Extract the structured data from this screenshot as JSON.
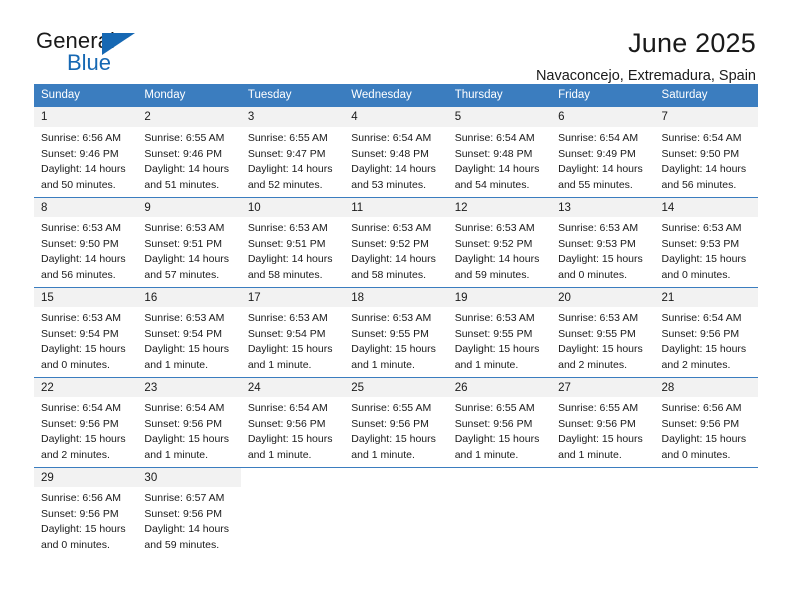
{
  "brand": {
    "name_part1": "General",
    "name_part2": "Blue",
    "accent_color": "#1668b3"
  },
  "header": {
    "title": "June 2025",
    "subtitle": "Navaconcejo, Extremadura, Spain"
  },
  "calendar": {
    "header_bg": "#3b7dbf",
    "daynum_bg": "#f2f2f2",
    "weekday_headers": [
      "Sunday",
      "Monday",
      "Tuesday",
      "Wednesday",
      "Thursday",
      "Friday",
      "Saturday"
    ],
    "weeks": [
      [
        {
          "day": "1",
          "sunrise": "Sunrise: 6:56 AM",
          "sunset": "Sunset: 9:46 PM",
          "daylight1": "Daylight: 14 hours",
          "daylight2": "and 50 minutes."
        },
        {
          "day": "2",
          "sunrise": "Sunrise: 6:55 AM",
          "sunset": "Sunset: 9:46 PM",
          "daylight1": "Daylight: 14 hours",
          "daylight2": "and 51 minutes."
        },
        {
          "day": "3",
          "sunrise": "Sunrise: 6:55 AM",
          "sunset": "Sunset: 9:47 PM",
          "daylight1": "Daylight: 14 hours",
          "daylight2": "and 52 minutes."
        },
        {
          "day": "4",
          "sunrise": "Sunrise: 6:54 AM",
          "sunset": "Sunset: 9:48 PM",
          "daylight1": "Daylight: 14 hours",
          "daylight2": "and 53 minutes."
        },
        {
          "day": "5",
          "sunrise": "Sunrise: 6:54 AM",
          "sunset": "Sunset: 9:48 PM",
          "daylight1": "Daylight: 14 hours",
          "daylight2": "and 54 minutes."
        },
        {
          "day": "6",
          "sunrise": "Sunrise: 6:54 AM",
          "sunset": "Sunset: 9:49 PM",
          "daylight1": "Daylight: 14 hours",
          "daylight2": "and 55 minutes."
        },
        {
          "day": "7",
          "sunrise": "Sunrise: 6:54 AM",
          "sunset": "Sunset: 9:50 PM",
          "daylight1": "Daylight: 14 hours",
          "daylight2": "and 56 minutes."
        }
      ],
      [
        {
          "day": "8",
          "sunrise": "Sunrise: 6:53 AM",
          "sunset": "Sunset: 9:50 PM",
          "daylight1": "Daylight: 14 hours",
          "daylight2": "and 56 minutes."
        },
        {
          "day": "9",
          "sunrise": "Sunrise: 6:53 AM",
          "sunset": "Sunset: 9:51 PM",
          "daylight1": "Daylight: 14 hours",
          "daylight2": "and 57 minutes."
        },
        {
          "day": "10",
          "sunrise": "Sunrise: 6:53 AM",
          "sunset": "Sunset: 9:51 PM",
          "daylight1": "Daylight: 14 hours",
          "daylight2": "and 58 minutes."
        },
        {
          "day": "11",
          "sunrise": "Sunrise: 6:53 AM",
          "sunset": "Sunset: 9:52 PM",
          "daylight1": "Daylight: 14 hours",
          "daylight2": "and 58 minutes."
        },
        {
          "day": "12",
          "sunrise": "Sunrise: 6:53 AM",
          "sunset": "Sunset: 9:52 PM",
          "daylight1": "Daylight: 14 hours",
          "daylight2": "and 59 minutes."
        },
        {
          "day": "13",
          "sunrise": "Sunrise: 6:53 AM",
          "sunset": "Sunset: 9:53 PM",
          "daylight1": "Daylight: 15 hours",
          "daylight2": "and 0 minutes."
        },
        {
          "day": "14",
          "sunrise": "Sunrise: 6:53 AM",
          "sunset": "Sunset: 9:53 PM",
          "daylight1": "Daylight: 15 hours",
          "daylight2": "and 0 minutes."
        }
      ],
      [
        {
          "day": "15",
          "sunrise": "Sunrise: 6:53 AM",
          "sunset": "Sunset: 9:54 PM",
          "daylight1": "Daylight: 15 hours",
          "daylight2": "and 0 minutes."
        },
        {
          "day": "16",
          "sunrise": "Sunrise: 6:53 AM",
          "sunset": "Sunset: 9:54 PM",
          "daylight1": "Daylight: 15 hours",
          "daylight2": "and 1 minute."
        },
        {
          "day": "17",
          "sunrise": "Sunrise: 6:53 AM",
          "sunset": "Sunset: 9:54 PM",
          "daylight1": "Daylight: 15 hours",
          "daylight2": "and 1 minute."
        },
        {
          "day": "18",
          "sunrise": "Sunrise: 6:53 AM",
          "sunset": "Sunset: 9:55 PM",
          "daylight1": "Daylight: 15 hours",
          "daylight2": "and 1 minute."
        },
        {
          "day": "19",
          "sunrise": "Sunrise: 6:53 AM",
          "sunset": "Sunset: 9:55 PM",
          "daylight1": "Daylight: 15 hours",
          "daylight2": "and 1 minute."
        },
        {
          "day": "20",
          "sunrise": "Sunrise: 6:53 AM",
          "sunset": "Sunset: 9:55 PM",
          "daylight1": "Daylight: 15 hours",
          "daylight2": "and 2 minutes."
        },
        {
          "day": "21",
          "sunrise": "Sunrise: 6:54 AM",
          "sunset": "Sunset: 9:56 PM",
          "daylight1": "Daylight: 15 hours",
          "daylight2": "and 2 minutes."
        }
      ],
      [
        {
          "day": "22",
          "sunrise": "Sunrise: 6:54 AM",
          "sunset": "Sunset: 9:56 PM",
          "daylight1": "Daylight: 15 hours",
          "daylight2": "and 2 minutes."
        },
        {
          "day": "23",
          "sunrise": "Sunrise: 6:54 AM",
          "sunset": "Sunset: 9:56 PM",
          "daylight1": "Daylight: 15 hours",
          "daylight2": "and 1 minute."
        },
        {
          "day": "24",
          "sunrise": "Sunrise: 6:54 AM",
          "sunset": "Sunset: 9:56 PM",
          "daylight1": "Daylight: 15 hours",
          "daylight2": "and 1 minute."
        },
        {
          "day": "25",
          "sunrise": "Sunrise: 6:55 AM",
          "sunset": "Sunset: 9:56 PM",
          "daylight1": "Daylight: 15 hours",
          "daylight2": "and 1 minute."
        },
        {
          "day": "26",
          "sunrise": "Sunrise: 6:55 AM",
          "sunset": "Sunset: 9:56 PM",
          "daylight1": "Daylight: 15 hours",
          "daylight2": "and 1 minute."
        },
        {
          "day": "27",
          "sunrise": "Sunrise: 6:55 AM",
          "sunset": "Sunset: 9:56 PM",
          "daylight1": "Daylight: 15 hours",
          "daylight2": "and 1 minute."
        },
        {
          "day": "28",
          "sunrise": "Sunrise: 6:56 AM",
          "sunset": "Sunset: 9:56 PM",
          "daylight1": "Daylight: 15 hours",
          "daylight2": "and 0 minutes."
        }
      ],
      [
        {
          "day": "29",
          "sunrise": "Sunrise: 6:56 AM",
          "sunset": "Sunset: 9:56 PM",
          "daylight1": "Daylight: 15 hours",
          "daylight2": "and 0 minutes."
        },
        {
          "day": "30",
          "sunrise": "Sunrise: 6:57 AM",
          "sunset": "Sunset: 9:56 PM",
          "daylight1": "Daylight: 14 hours",
          "daylight2": "and 59 minutes."
        },
        {
          "day": "",
          "sunrise": "",
          "sunset": "",
          "daylight1": "",
          "daylight2": ""
        },
        {
          "day": "",
          "sunrise": "",
          "sunset": "",
          "daylight1": "",
          "daylight2": ""
        },
        {
          "day": "",
          "sunrise": "",
          "sunset": "",
          "daylight1": "",
          "daylight2": ""
        },
        {
          "day": "",
          "sunrise": "",
          "sunset": "",
          "daylight1": "",
          "daylight2": ""
        },
        {
          "day": "",
          "sunrise": "",
          "sunset": "",
          "daylight1": "",
          "daylight2": ""
        }
      ]
    ]
  }
}
